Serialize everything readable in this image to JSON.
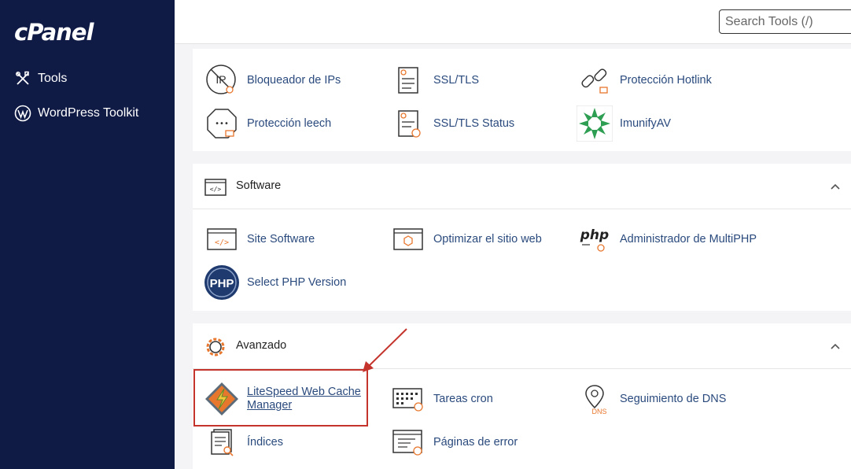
{
  "sidebar": {
    "logo": "cPanel",
    "items": [
      {
        "label": "Tools",
        "icon": "tools-icon"
      },
      {
        "label": "WordPress Toolkit",
        "icon": "wordpress-icon"
      }
    ]
  },
  "header": {
    "search_placeholder": "Search Tools (/)"
  },
  "security": {
    "tools": [
      {
        "label": "Bloqueador de IPs"
      },
      {
        "label": "SSL/TLS"
      },
      {
        "label": "Protección Hotlink"
      },
      {
        "label": "Protección leech"
      },
      {
        "label": "SSL/TLS Status"
      },
      {
        "label": "ImunifyAV"
      }
    ]
  },
  "software": {
    "title": "Software",
    "tools": [
      {
        "label": "Site Software"
      },
      {
        "label": "Optimizar el sitio web"
      },
      {
        "label": "Administrador de MultiPHP"
      },
      {
        "label": "Select PHP Version"
      }
    ]
  },
  "advanced": {
    "title": "Avanzado",
    "tools": [
      {
        "label": "LiteSpeed Web Cache Manager"
      },
      {
        "label": "Tareas cron"
      },
      {
        "label": "Seguimiento de DNS"
      },
      {
        "label": "Índices"
      },
      {
        "label": "Páginas de error"
      }
    ]
  },
  "icon_text": {
    "ip": "IP",
    "php_badge": "PHP",
    "php_logo": "php",
    "dns": "DNS",
    "leech_dots": "•••",
    "code": "</>"
  },
  "colors": {
    "sidebar_bg": "#0f1a45",
    "link": "#2a4a7d",
    "accent_orange": "#e8772e",
    "highlight_red": "#c4342c"
  }
}
